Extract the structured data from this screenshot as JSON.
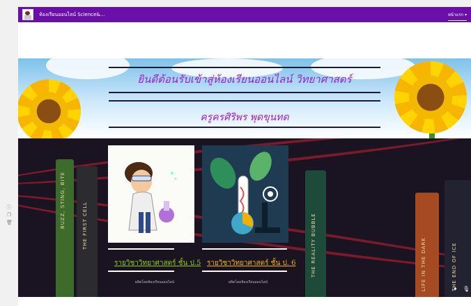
{
  "header": {
    "site_title": "ห้องเรียนออนไลน์ Science&...",
    "nav_page": "หน้าแรก"
  },
  "banner": {
    "line1": "ยินดีต้อนรับเข้าสู่ห้องเรียนออนไลน์ วิทยาศาสตร์",
    "line2": "ครูครศิริพร พุดขุนทด"
  },
  "cards": [
    {
      "title": "รายวิชาวิทยาศาสตร์ ชั้น ป.5",
      "subtitle": "ผลิตโดยห้องเรียนออนไลน์",
      "link_color": "#8ed000"
    },
    {
      "title": "รายวิชาวิทยาศาสตร์ ชั้น ป. 6",
      "subtitle": "ผลิตโดยห้องเรียนออนไลน์",
      "link_color": "#f4b400"
    }
  ],
  "background_books": [
    "BUZZ, STING, BITE",
    "THE FIRST CELL",
    "THE REALITY BUBBLE",
    "THE END OF ICE",
    "LIFE IN THE DARK"
  ],
  "colors": {
    "header": "#6a10a8",
    "banner_text": "#9a1fd0",
    "dark_bg": "#1a1422"
  }
}
